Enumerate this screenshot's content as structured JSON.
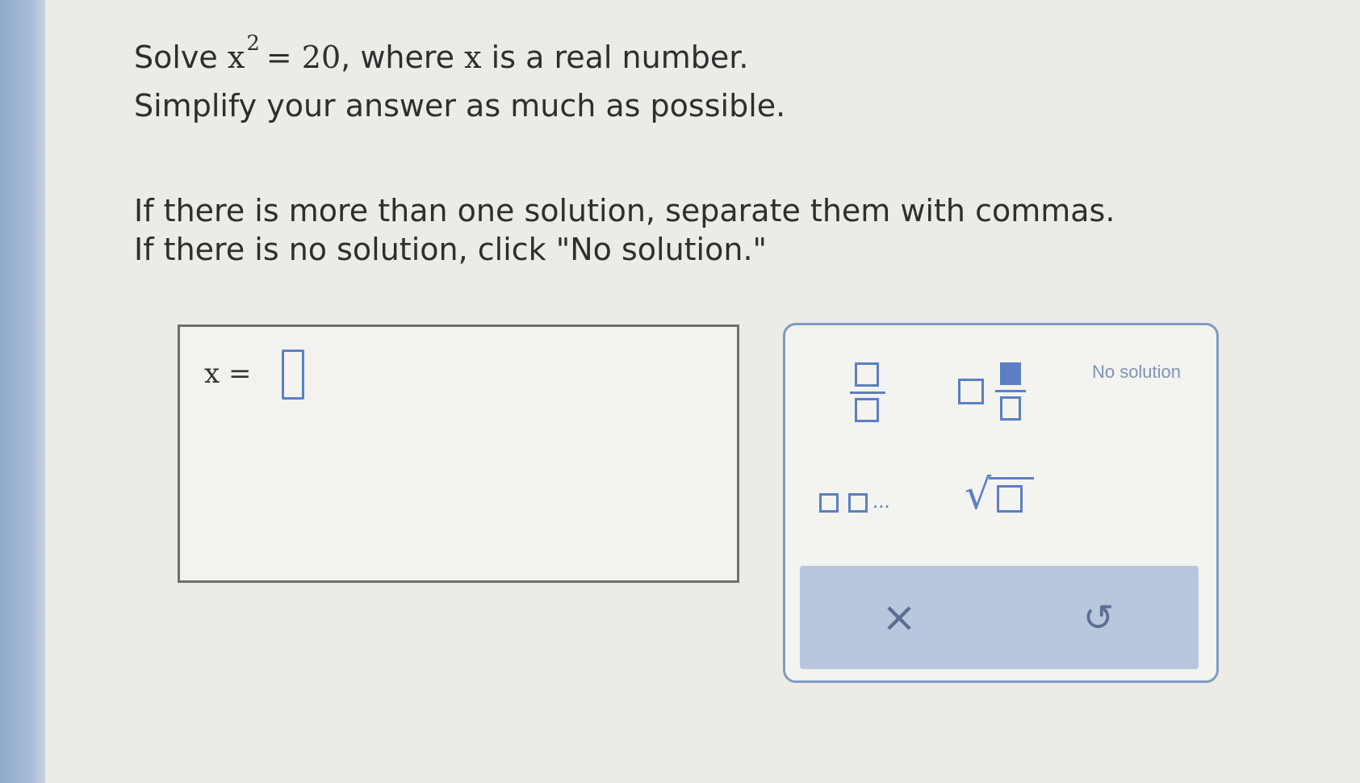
{
  "question": {
    "solve_word": "Solve",
    "var_x": "x",
    "exponent": "2",
    "equation_rhs": "= 20",
    "where_text": ", where",
    "var_x2": "x",
    "real_text": "is a real number.",
    "simplify": "Simplify your answer as much as possible.",
    "instruction_multiple": "If there is more than one solution, separate them with commas.",
    "instruction_none": "If there is no solution, click \"No solution.\""
  },
  "answer": {
    "label": "x =",
    "value": ""
  },
  "palette": {
    "fraction_icon": "fraction-icon",
    "mixed_number_icon": "mixed-number-icon",
    "no_solution_label": "No solution",
    "list_icon": "comma-list-icon",
    "list_dots": "...",
    "sqrt_icon": "square-root-icon",
    "sqrt_symbol": "√",
    "clear_label": "×",
    "undo_label": "↺"
  },
  "colors": {
    "accent": "#5b7fc2",
    "action_bar": "#b8c7de",
    "left_bar": "#a9bdd6"
  }
}
